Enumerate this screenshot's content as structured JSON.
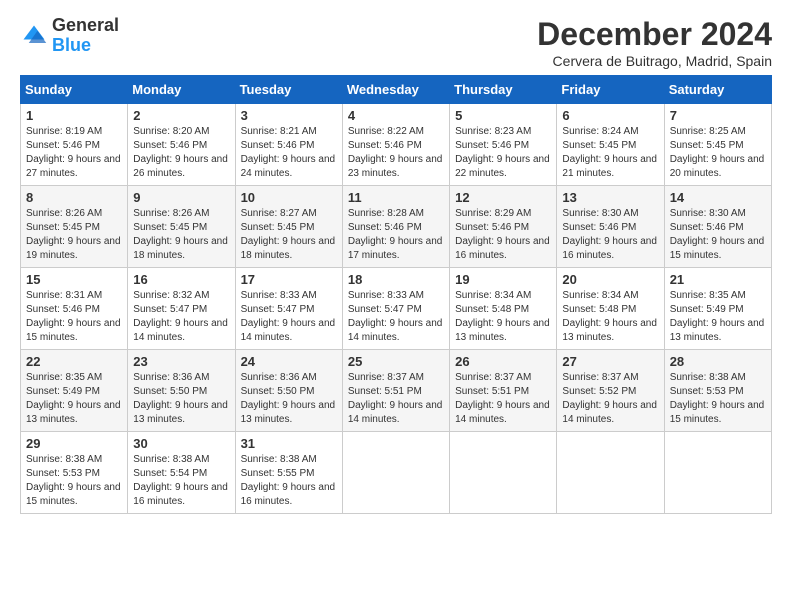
{
  "logo": {
    "general": "General",
    "blue": "Blue"
  },
  "title": "December 2024",
  "location": "Cervera de Buitrago, Madrid, Spain",
  "headers": [
    "Sunday",
    "Monday",
    "Tuesday",
    "Wednesday",
    "Thursday",
    "Friday",
    "Saturday"
  ],
  "weeks": [
    [
      {
        "day": "1",
        "sunrise": "8:19 AM",
        "sunset": "5:46 PM",
        "daylight": "9 hours and 27 minutes."
      },
      {
        "day": "2",
        "sunrise": "8:20 AM",
        "sunset": "5:46 PM",
        "daylight": "9 hours and 26 minutes."
      },
      {
        "day": "3",
        "sunrise": "8:21 AM",
        "sunset": "5:46 PM",
        "daylight": "9 hours and 24 minutes."
      },
      {
        "day": "4",
        "sunrise": "8:22 AM",
        "sunset": "5:46 PM",
        "daylight": "9 hours and 23 minutes."
      },
      {
        "day": "5",
        "sunrise": "8:23 AM",
        "sunset": "5:46 PM",
        "daylight": "9 hours and 22 minutes."
      },
      {
        "day": "6",
        "sunrise": "8:24 AM",
        "sunset": "5:45 PM",
        "daylight": "9 hours and 21 minutes."
      },
      {
        "day": "7",
        "sunrise": "8:25 AM",
        "sunset": "5:45 PM",
        "daylight": "9 hours and 20 minutes."
      }
    ],
    [
      {
        "day": "8",
        "sunrise": "8:26 AM",
        "sunset": "5:45 PM",
        "daylight": "9 hours and 19 minutes."
      },
      {
        "day": "9",
        "sunrise": "8:26 AM",
        "sunset": "5:45 PM",
        "daylight": "9 hours and 18 minutes."
      },
      {
        "day": "10",
        "sunrise": "8:27 AM",
        "sunset": "5:45 PM",
        "daylight": "9 hours and 18 minutes."
      },
      {
        "day": "11",
        "sunrise": "8:28 AM",
        "sunset": "5:46 PM",
        "daylight": "9 hours and 17 minutes."
      },
      {
        "day": "12",
        "sunrise": "8:29 AM",
        "sunset": "5:46 PM",
        "daylight": "9 hours and 16 minutes."
      },
      {
        "day": "13",
        "sunrise": "8:30 AM",
        "sunset": "5:46 PM",
        "daylight": "9 hours and 16 minutes."
      },
      {
        "day": "14",
        "sunrise": "8:30 AM",
        "sunset": "5:46 PM",
        "daylight": "9 hours and 15 minutes."
      }
    ],
    [
      {
        "day": "15",
        "sunrise": "8:31 AM",
        "sunset": "5:46 PM",
        "daylight": "9 hours and 15 minutes."
      },
      {
        "day": "16",
        "sunrise": "8:32 AM",
        "sunset": "5:47 PM",
        "daylight": "9 hours and 14 minutes."
      },
      {
        "day": "17",
        "sunrise": "8:33 AM",
        "sunset": "5:47 PM",
        "daylight": "9 hours and 14 minutes."
      },
      {
        "day": "18",
        "sunrise": "8:33 AM",
        "sunset": "5:47 PM",
        "daylight": "9 hours and 14 minutes."
      },
      {
        "day": "19",
        "sunrise": "8:34 AM",
        "sunset": "5:48 PM",
        "daylight": "9 hours and 13 minutes."
      },
      {
        "day": "20",
        "sunrise": "8:34 AM",
        "sunset": "5:48 PM",
        "daylight": "9 hours and 13 minutes."
      },
      {
        "day": "21",
        "sunrise": "8:35 AM",
        "sunset": "5:49 PM",
        "daylight": "9 hours and 13 minutes."
      }
    ],
    [
      {
        "day": "22",
        "sunrise": "8:35 AM",
        "sunset": "5:49 PM",
        "daylight": "9 hours and 13 minutes."
      },
      {
        "day": "23",
        "sunrise": "8:36 AM",
        "sunset": "5:50 PM",
        "daylight": "9 hours and 13 minutes."
      },
      {
        "day": "24",
        "sunrise": "8:36 AM",
        "sunset": "5:50 PM",
        "daylight": "9 hours and 13 minutes."
      },
      {
        "day": "25",
        "sunrise": "8:37 AM",
        "sunset": "5:51 PM",
        "daylight": "9 hours and 14 minutes."
      },
      {
        "day": "26",
        "sunrise": "8:37 AM",
        "sunset": "5:51 PM",
        "daylight": "9 hours and 14 minutes."
      },
      {
        "day": "27",
        "sunrise": "8:37 AM",
        "sunset": "5:52 PM",
        "daylight": "9 hours and 14 minutes."
      },
      {
        "day": "28",
        "sunrise": "8:38 AM",
        "sunset": "5:53 PM",
        "daylight": "9 hours and 15 minutes."
      }
    ],
    [
      {
        "day": "29",
        "sunrise": "8:38 AM",
        "sunset": "5:53 PM",
        "daylight": "9 hours and 15 minutes."
      },
      {
        "day": "30",
        "sunrise": "8:38 AM",
        "sunset": "5:54 PM",
        "daylight": "9 hours and 16 minutes."
      },
      {
        "day": "31",
        "sunrise": "8:38 AM",
        "sunset": "5:55 PM",
        "daylight": "9 hours and 16 minutes."
      },
      null,
      null,
      null,
      null
    ]
  ]
}
